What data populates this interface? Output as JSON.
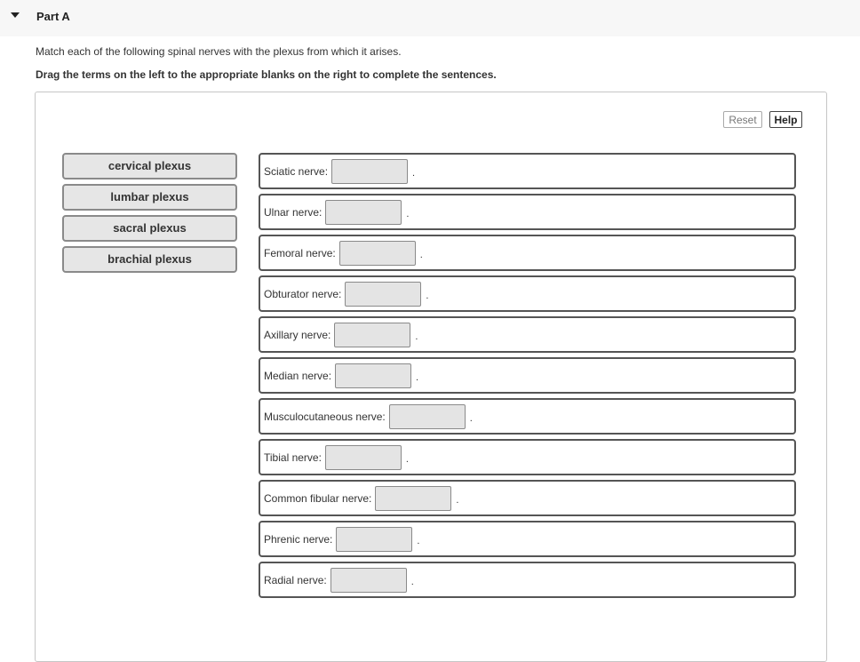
{
  "part": {
    "title": "Part A"
  },
  "instructions": {
    "line1": "Match each of the following spinal nerves with the plexus from which it arises.",
    "line2": "Drag the terms on the left to the appropriate blanks on the right to complete the sentences."
  },
  "toolbar": {
    "reset_label": "Reset",
    "help_label": "Help"
  },
  "terms": [
    "cervical plexus",
    "lumbar plexus",
    "sacral plexus",
    "brachial plexus"
  ],
  "sentences": [
    {
      "label": "Sciatic nerve:",
      "end": "."
    },
    {
      "label": "Ulnar nerve:",
      "end": "."
    },
    {
      "label": "Femoral nerve:",
      "end": "."
    },
    {
      "label": "Obturator nerve:",
      "end": "."
    },
    {
      "label": "Axillary nerve:",
      "end": "."
    },
    {
      "label": "Median nerve:",
      "end": "."
    },
    {
      "label": "Musculocutaneous nerve:",
      "end": "."
    },
    {
      "label": "Tibial nerve:",
      "end": "."
    },
    {
      "label": "Common fibular nerve:",
      "end": "."
    },
    {
      "label": "Phrenic nerve:",
      "end": "."
    },
    {
      "label": "Radial nerve:",
      "end": "."
    }
  ]
}
